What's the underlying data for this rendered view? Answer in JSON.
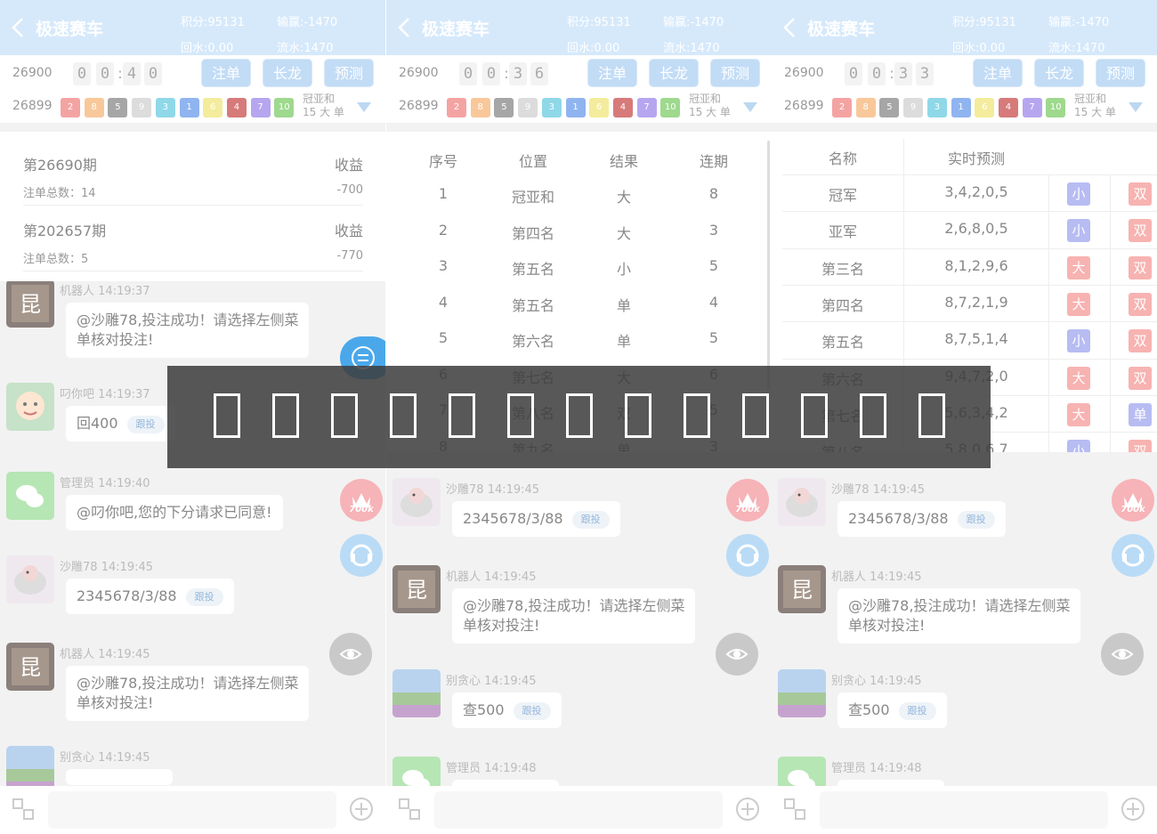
{
  "panels": [
    {
      "header": {
        "title": "极速赛车",
        "score": "积分:95131",
        "win_loss": "输赢:-1470",
        "rebate": "回水:0.00",
        "flow": "流水:1470"
      },
      "current_period": "26900",
      "countdown": [
        "0",
        "0",
        "4",
        "0"
      ],
      "last_period": "26899",
      "buttons": {
        "bet": "注单",
        "dragon": "长龙",
        "predict": "预测"
      },
      "balls": [
        "2",
        "8",
        "5",
        "9",
        "3",
        "1",
        "6",
        "4",
        "7",
        "10"
      ],
      "ball_info": {
        "line1": "冠亚和",
        "line2": "15 大 单"
      }
    },
    {
      "header": {
        "title": "极速赛车",
        "score": "积分:95131",
        "win_loss": "输赢:-1470",
        "rebate": "回水:0.00",
        "flow": "流水:1470"
      },
      "current_period": "26900",
      "countdown": [
        "0",
        "0",
        "3",
        "6"
      ],
      "last_period": "26899",
      "buttons": {
        "bet": "注单",
        "dragon": "长龙",
        "predict": "预测"
      },
      "balls": [
        "2",
        "8",
        "5",
        "9",
        "3",
        "1",
        "6",
        "4",
        "7",
        "10"
      ],
      "ball_info": {
        "line1": "冠亚和",
        "line2": "15 大 单"
      }
    },
    {
      "header": {
        "title": "极速赛车",
        "score": "积分:95131",
        "win_loss": "输赢:-1470",
        "rebate": "回水:0.00",
        "flow": "流水:1470"
      },
      "current_period": "26900",
      "countdown": [
        "0",
        "0",
        "3",
        "3"
      ],
      "last_period": "26899",
      "buttons": {
        "bet": "注单",
        "dragon": "长龙",
        "predict": "预测"
      },
      "balls": [
        "2",
        "8",
        "5",
        "9",
        "3",
        "1",
        "6",
        "4",
        "7",
        "10"
      ],
      "ball_info": {
        "line1": "冠亚和",
        "line2": "15 大 单"
      }
    }
  ],
  "ball_colors": [
    "#8fb4f0",
    "#f4a3a3",
    "#8fd8e8",
    "#d77a7a",
    "#a6a6a6",
    "#f4ec9c",
    "#b6a6f0",
    "#f8c89a",
    "#dcdcdc",
    "#9ed98e"
  ],
  "summary": [
    {
      "title": "第26690期",
      "profit_label": "收益",
      "count_label": "注单总数：14",
      "value": "-700"
    },
    {
      "title": "第202657期",
      "profit_label": "收益",
      "count_label": "注单总数：5",
      "value": "-770"
    }
  ],
  "dragon_table": {
    "headers": [
      "序号",
      "位置",
      "结果",
      "连期"
    ],
    "rows": [
      [
        "1",
        "冠亚和",
        "大",
        "8"
      ],
      [
        "2",
        "第四名",
        "大",
        "3"
      ],
      [
        "3",
        "第五名",
        "小",
        "5"
      ],
      [
        "4",
        "第五名",
        "单",
        "4"
      ],
      [
        "5",
        "第六名",
        "单",
        "5"
      ],
      [
        "6",
        "第七名",
        "大",
        "6"
      ],
      [
        "7",
        "第八名",
        "双",
        "5"
      ],
      [
        "8",
        "第九名",
        "单",
        "3"
      ]
    ]
  },
  "predict_table": {
    "headers": [
      "名称",
      "实时预测"
    ],
    "rows": [
      {
        "name": "冠军",
        "nums": "3,4,2,0,5",
        "size": "小",
        "parity": "双"
      },
      {
        "name": "亚军",
        "nums": "2,6,8,0,5",
        "size": "小",
        "parity": "双"
      },
      {
        "name": "第三名",
        "nums": "8,1,2,9,6",
        "size": "大",
        "parity": "双"
      },
      {
        "name": "第四名",
        "nums": "8,7,2,1,9",
        "size": "大",
        "parity": "双"
      },
      {
        "name": "第五名",
        "nums": "8,7,5,1,4",
        "size": "小",
        "parity": "双"
      },
      {
        "name": "第六名",
        "nums": "9,4,7,2,0",
        "size": "大",
        "parity": "双"
      },
      {
        "name": "第七名",
        "nums": "5,6,3,4,2",
        "size": "大",
        "parity": "单"
      },
      {
        "name": "第八名",
        "nums": "5,8,0,6,7",
        "size": "小",
        "parity": "双"
      }
    ]
  },
  "chat_left": [
    {
      "user": "机器人",
      "time": "14:19:37",
      "text_line1": "@沙雕78,投注成功！请选择左侧菜",
      "text_line2": "单核对投注!"
    },
    {
      "user": "叼你吧",
      "time": "14:19:37",
      "text": "回400",
      "follow": "跟投"
    },
    {
      "user": "管理员",
      "time": "14:19:40",
      "text": "@叼你吧,您的下分请求已同意!"
    },
    {
      "user": "沙雕78",
      "time": "14:19:45",
      "text": "2345678/3/88",
      "follow": "跟投"
    },
    {
      "user": "机器人",
      "time": "14:19:45",
      "text_line1": "@沙雕78,投注成功！请选择左侧菜",
      "text_line2": "单核对投注!"
    },
    {
      "user": "别贪心",
      "time": "14:19:45",
      "text": ""
    }
  ],
  "chat_right": [
    {
      "user": "沙雕78",
      "time": "14:19:45",
      "text": "2345678/3/88",
      "follow": "跟投"
    },
    {
      "user": "机器人",
      "time": "14:19:45",
      "text_line1": "@沙雕78,投注成功！请选择左侧菜",
      "text_line2": "单核对投注!"
    },
    {
      "user": "别贪心",
      "time": "14:19:45",
      "text": "查500",
      "follow": "跟投"
    },
    {
      "user": "管理员",
      "time": "14:19:48",
      "text": ""
    }
  ],
  "crown_badge": "700k",
  "banner_chars": 13,
  "colors": {
    "header": "#d6e9fb",
    "button": "#c2dcf6",
    "background": "#f2f2f2",
    "banner": "#3c3c3c"
  }
}
